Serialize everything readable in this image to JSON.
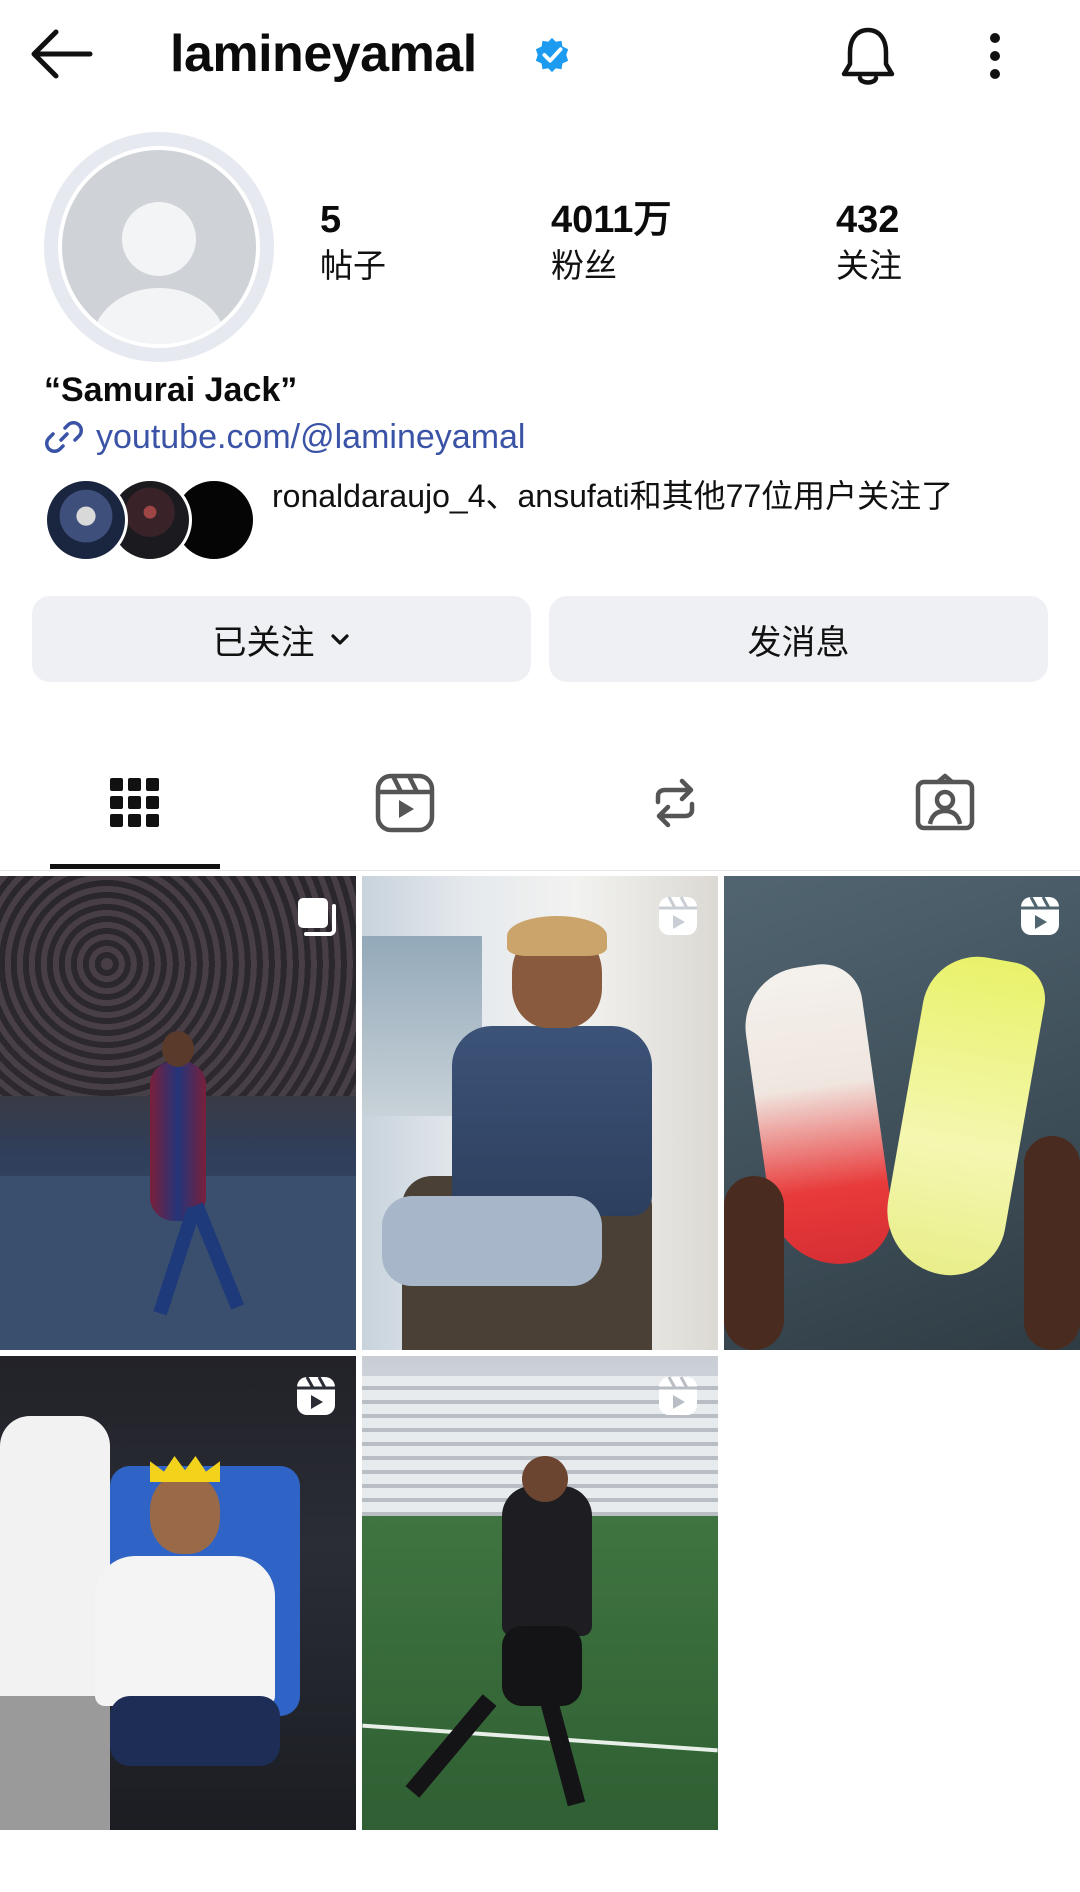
{
  "header": {
    "username": "lamineyamal",
    "icons": {
      "back": "arrow-left-icon",
      "verified": "verified-badge-icon",
      "notifications": "bell-icon",
      "more": "more-vertical-icon"
    }
  },
  "profile": {
    "stats": [
      {
        "value": "5",
        "label": "帖子"
      },
      {
        "value": "4011万",
        "label": "粉丝"
      },
      {
        "value": "432",
        "label": "关注"
      }
    ],
    "bio": "“Samurai Jack”",
    "link": "youtube.com/@lamineyamal",
    "mutual_followers": "ronaldaraujo_4、ansufati和其他77位用户关注了"
  },
  "actions": {
    "follow_label": "已关注",
    "message_label": "发消息"
  },
  "tabs": [
    {
      "id": "posts",
      "icon": "grid-icon",
      "active": true
    },
    {
      "id": "reels",
      "icon": "reels-icon",
      "active": false
    },
    {
      "id": "reposts",
      "icon": "repost-icon",
      "active": false
    },
    {
      "id": "tagged",
      "icon": "tagged-user-icon",
      "active": false
    }
  ],
  "posts": [
    {
      "badge": "carousel-icon"
    },
    {
      "badge": "reels-icon"
    },
    {
      "badge": "reels-icon"
    },
    {
      "badge": "reels-icon"
    },
    {
      "badge": "reels-icon"
    }
  ],
  "colors": {
    "link": "#3b53a6",
    "verified": "#1d9bf0",
    "button_bg": "#eff0f3"
  }
}
